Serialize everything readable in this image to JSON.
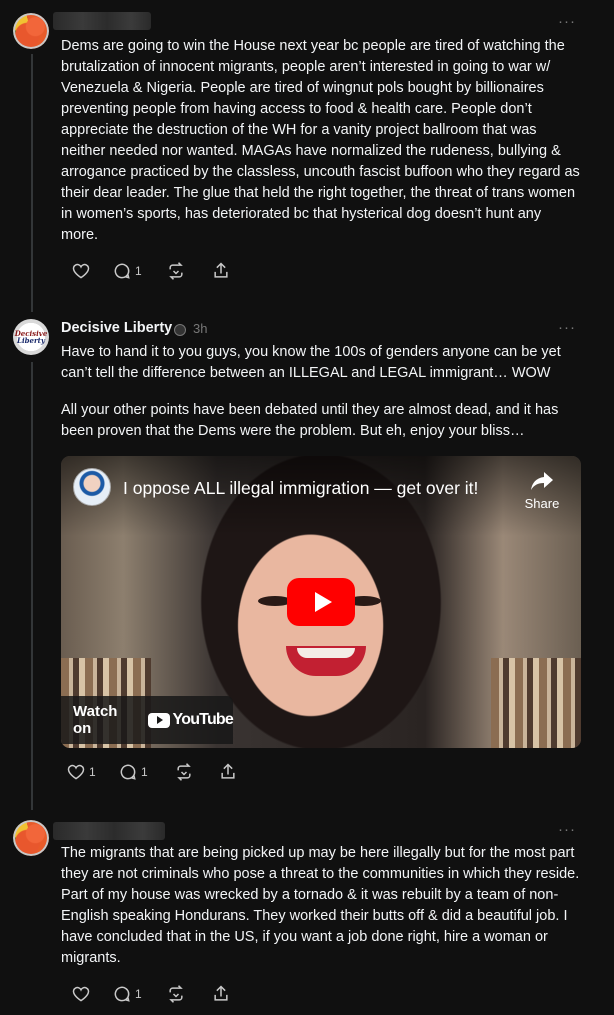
{
  "posts": [
    {
      "author": "",
      "text": "Dems are going to win the House next year bc people are tired of watching the brutalization of innocent migrants, people aren’t interested in going to war w/ Venezuela & Nigeria. People are tired of wingnut pols bought by billionaires preventing people from having access to food & health care. People don’t appreciate the destruction of the WH for a vanity project ballroom that was neither needed nor wanted. MAGAs have normalized the rudeness, bullying & arrogance practiced by the classless, uncouth fascist buffoon who they regard as their dear leader. The glue that held the right together, the threat of trans women in women’s sports, has deteriorated bc that hysterical dog doesn’t hunt any more.",
      "likes": "",
      "replies": "1"
    },
    {
      "author": "Decisive Liberty",
      "time": "3h",
      "avatar_text": [
        "Decisive",
        "Liberty"
      ],
      "text_p1": "Have to hand it to you guys, you know the 100s of genders anyone can be yet can’t tell the difference between an ILLEGAL and LEGAL immigrant… WOW",
      "text_p2": "All your other points have been debated until they are almost dead, and it has been proven that the Dems were the problem. But eh, enjoy your bliss…",
      "video": {
        "title": "I oppose ALL illegal immigration — get over it!",
        "share_label": "Share",
        "watch_on_label": "Watch on",
        "youtube_label": "YouTube"
      },
      "likes": "1",
      "replies": "1"
    },
    {
      "author": "",
      "text": "The migrants that are being picked up may be here illegally but for the most part they are not criminals who pose a threat to the communities in which they reside. Part of my house was wrecked by a tornado & it was rebuilt by a team of non-English speaking Hondurans. They worked their butts off & did a beautiful job. I have concluded that in the US, if you want a job done right, hire a woman or migrants.",
      "likes": "",
      "replies": "1"
    }
  ],
  "more_label": "···",
  "icons": [
    "heart-icon",
    "comment-icon",
    "repost-icon",
    "share-icon",
    "more-icon",
    "play-icon",
    "share-arrow-icon",
    "youtube-logo-icon"
  ],
  "colors": {
    "background": "#101010",
    "text": "#f3f5f7",
    "muted": "#777777",
    "youtube_red": "#ff0000"
  }
}
